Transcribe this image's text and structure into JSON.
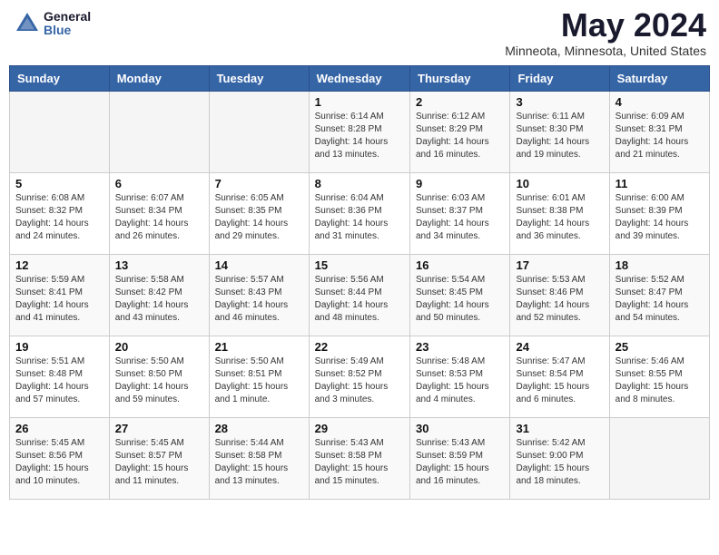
{
  "header": {
    "logo_line1": "General",
    "logo_line2": "Blue",
    "month": "May 2024",
    "location": "Minneota, Minnesota, United States"
  },
  "weekdays": [
    "Sunday",
    "Monday",
    "Tuesday",
    "Wednesday",
    "Thursday",
    "Friday",
    "Saturday"
  ],
  "weeks": [
    [
      {
        "day": "",
        "info": ""
      },
      {
        "day": "",
        "info": ""
      },
      {
        "day": "",
        "info": ""
      },
      {
        "day": "1",
        "info": "Sunrise: 6:14 AM\nSunset: 8:28 PM\nDaylight: 14 hours\nand 13 minutes."
      },
      {
        "day": "2",
        "info": "Sunrise: 6:12 AM\nSunset: 8:29 PM\nDaylight: 14 hours\nand 16 minutes."
      },
      {
        "day": "3",
        "info": "Sunrise: 6:11 AM\nSunset: 8:30 PM\nDaylight: 14 hours\nand 19 minutes."
      },
      {
        "day": "4",
        "info": "Sunrise: 6:09 AM\nSunset: 8:31 PM\nDaylight: 14 hours\nand 21 minutes."
      }
    ],
    [
      {
        "day": "5",
        "info": "Sunrise: 6:08 AM\nSunset: 8:32 PM\nDaylight: 14 hours\nand 24 minutes."
      },
      {
        "day": "6",
        "info": "Sunrise: 6:07 AM\nSunset: 8:34 PM\nDaylight: 14 hours\nand 26 minutes."
      },
      {
        "day": "7",
        "info": "Sunrise: 6:05 AM\nSunset: 8:35 PM\nDaylight: 14 hours\nand 29 minutes."
      },
      {
        "day": "8",
        "info": "Sunrise: 6:04 AM\nSunset: 8:36 PM\nDaylight: 14 hours\nand 31 minutes."
      },
      {
        "day": "9",
        "info": "Sunrise: 6:03 AM\nSunset: 8:37 PM\nDaylight: 14 hours\nand 34 minutes."
      },
      {
        "day": "10",
        "info": "Sunrise: 6:01 AM\nSunset: 8:38 PM\nDaylight: 14 hours\nand 36 minutes."
      },
      {
        "day": "11",
        "info": "Sunrise: 6:00 AM\nSunset: 8:39 PM\nDaylight: 14 hours\nand 39 minutes."
      }
    ],
    [
      {
        "day": "12",
        "info": "Sunrise: 5:59 AM\nSunset: 8:41 PM\nDaylight: 14 hours\nand 41 minutes."
      },
      {
        "day": "13",
        "info": "Sunrise: 5:58 AM\nSunset: 8:42 PM\nDaylight: 14 hours\nand 43 minutes."
      },
      {
        "day": "14",
        "info": "Sunrise: 5:57 AM\nSunset: 8:43 PM\nDaylight: 14 hours\nand 46 minutes."
      },
      {
        "day": "15",
        "info": "Sunrise: 5:56 AM\nSunset: 8:44 PM\nDaylight: 14 hours\nand 48 minutes."
      },
      {
        "day": "16",
        "info": "Sunrise: 5:54 AM\nSunset: 8:45 PM\nDaylight: 14 hours\nand 50 minutes."
      },
      {
        "day": "17",
        "info": "Sunrise: 5:53 AM\nSunset: 8:46 PM\nDaylight: 14 hours\nand 52 minutes."
      },
      {
        "day": "18",
        "info": "Sunrise: 5:52 AM\nSunset: 8:47 PM\nDaylight: 14 hours\nand 54 minutes."
      }
    ],
    [
      {
        "day": "19",
        "info": "Sunrise: 5:51 AM\nSunset: 8:48 PM\nDaylight: 14 hours\nand 57 minutes."
      },
      {
        "day": "20",
        "info": "Sunrise: 5:50 AM\nSunset: 8:50 PM\nDaylight: 14 hours\nand 59 minutes."
      },
      {
        "day": "21",
        "info": "Sunrise: 5:50 AM\nSunset: 8:51 PM\nDaylight: 15 hours\nand 1 minute."
      },
      {
        "day": "22",
        "info": "Sunrise: 5:49 AM\nSunset: 8:52 PM\nDaylight: 15 hours\nand 3 minutes."
      },
      {
        "day": "23",
        "info": "Sunrise: 5:48 AM\nSunset: 8:53 PM\nDaylight: 15 hours\nand 4 minutes."
      },
      {
        "day": "24",
        "info": "Sunrise: 5:47 AM\nSunset: 8:54 PM\nDaylight: 15 hours\nand 6 minutes."
      },
      {
        "day": "25",
        "info": "Sunrise: 5:46 AM\nSunset: 8:55 PM\nDaylight: 15 hours\nand 8 minutes."
      }
    ],
    [
      {
        "day": "26",
        "info": "Sunrise: 5:45 AM\nSunset: 8:56 PM\nDaylight: 15 hours\nand 10 minutes."
      },
      {
        "day": "27",
        "info": "Sunrise: 5:45 AM\nSunset: 8:57 PM\nDaylight: 15 hours\nand 11 minutes."
      },
      {
        "day": "28",
        "info": "Sunrise: 5:44 AM\nSunset: 8:58 PM\nDaylight: 15 hours\nand 13 minutes."
      },
      {
        "day": "29",
        "info": "Sunrise: 5:43 AM\nSunset: 8:58 PM\nDaylight: 15 hours\nand 15 minutes."
      },
      {
        "day": "30",
        "info": "Sunrise: 5:43 AM\nSunset: 8:59 PM\nDaylight: 15 hours\nand 16 minutes."
      },
      {
        "day": "31",
        "info": "Sunrise: 5:42 AM\nSunset: 9:00 PM\nDaylight: 15 hours\nand 18 minutes."
      },
      {
        "day": "",
        "info": ""
      }
    ]
  ]
}
